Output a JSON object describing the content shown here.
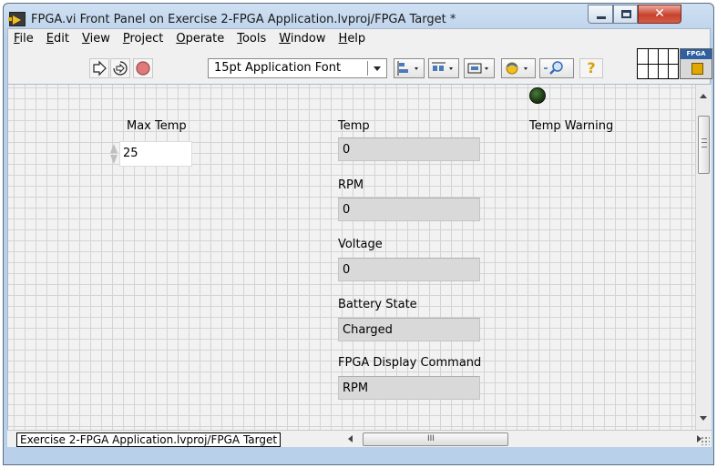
{
  "window": {
    "title": "FPGA.vi Front Panel on Exercise 2-FPGA Application.lvproj/FPGA Target *"
  },
  "menu": [
    {
      "label": "File",
      "key": "F",
      "rest": "ile"
    },
    {
      "label": "Edit",
      "key": "E",
      "rest": "dit"
    },
    {
      "label": "View",
      "key": "V",
      "rest": "iew"
    },
    {
      "label": "Project",
      "key": "P",
      "rest": "roject"
    },
    {
      "label": "Operate",
      "key": "O",
      "rest": "perate"
    },
    {
      "label": "Tools",
      "key": "T",
      "rest": "ools"
    },
    {
      "label": "Window",
      "key": "W",
      "rest": "indow"
    },
    {
      "label": "Help",
      "key": "H",
      "rest": "elp"
    }
  ],
  "toolbar": {
    "font": "15pt Application Font",
    "help_glyph": "?"
  },
  "fpga_badge": "FPGA",
  "controls": {
    "max_temp": {
      "label": "Max Temp",
      "value": "25"
    },
    "temp": {
      "label": "Temp",
      "value": "0"
    },
    "rpm": {
      "label": "RPM",
      "value": "0"
    },
    "voltage": {
      "label": "Voltage",
      "value": "0"
    },
    "battery_state": {
      "label": "Battery State",
      "value": "Charged"
    },
    "fpga_display_command": {
      "label": "FPGA Display Command",
      "value": "RPM"
    },
    "temp_warning": {
      "label": "Temp Warning",
      "state": "off",
      "off_color": "#1d3a14"
    }
  },
  "status_bar": {
    "path": "Exercise 2-FPGA Application.lvproj/FPGA Target",
    "hscroll_grip": "III"
  },
  "colors": {
    "title_gradient": "#b9d0ea",
    "close_button": "#c8412c",
    "panel_bg": "#f2f2f2",
    "indicator_bg": "#d9d9d9"
  }
}
